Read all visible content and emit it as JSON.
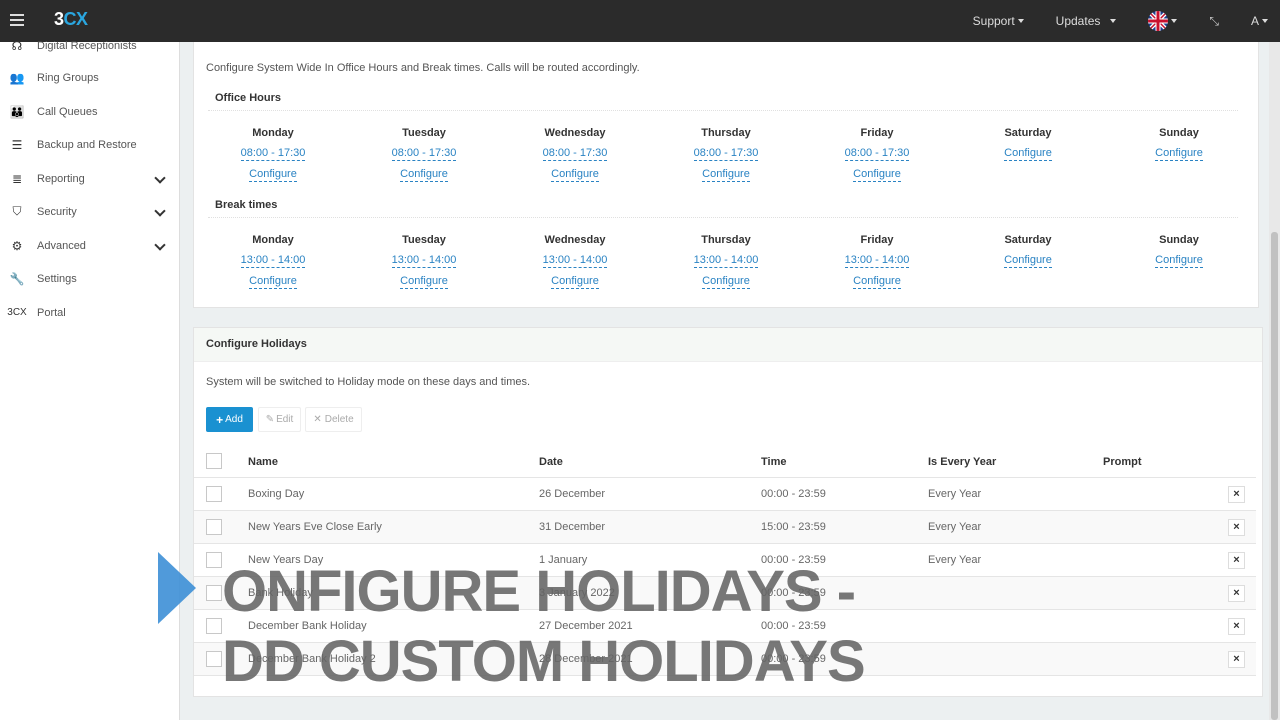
{
  "header": {
    "logo_main": "3",
    "logo_accent": "CX",
    "support_label": "Support",
    "updates_label": "Updates",
    "user_label": "A"
  },
  "sidebar": {
    "items": [
      {
        "label": "Digital Receptionists",
        "icon": "headset-icon"
      },
      {
        "label": "Ring Groups",
        "icon": "users-icon"
      },
      {
        "label": "Call Queues",
        "icon": "group-icon"
      },
      {
        "label": "Backup and Restore",
        "icon": "database-icon"
      },
      {
        "label": "Reporting",
        "icon": "list-icon"
      },
      {
        "label": "Security",
        "icon": "shield-icon"
      },
      {
        "label": "Advanced",
        "icon": "gear-icon"
      },
      {
        "label": "Settings",
        "icon": "wrench-icon"
      },
      {
        "label": "Portal",
        "icon": "3cx-icon"
      }
    ],
    "portal_icon_text": "3CX"
  },
  "office": {
    "description": "Configure System Wide In Office Hours and Break times. Calls will be routed accordingly.",
    "office_title": "Office Hours",
    "break_title": "Break times",
    "days": [
      "Monday",
      "Tuesday",
      "Wednesday",
      "Thursday",
      "Friday",
      "Saturday",
      "Sunday"
    ],
    "office_hours": [
      "08:00 - 17:30",
      "08:00 - 17:30",
      "08:00 - 17:30",
      "08:00 - 17:30",
      "08:00 - 17:30",
      "",
      ""
    ],
    "break_hours": [
      "13:00 - 14:00",
      "13:00 - 14:00",
      "13:00 - 14:00",
      "13:00 - 14:00",
      "13:00 - 14:00",
      "",
      ""
    ],
    "configure_label": "Configure"
  },
  "holidays": {
    "title": "Configure Holidays",
    "description": "System will be switched to Holiday mode on these days and times.",
    "add_label": "Add",
    "edit_label": "Edit",
    "delete_label": "Delete",
    "columns": [
      "Name",
      "Date",
      "Time",
      "Is Every Year",
      "Prompt"
    ],
    "rows": [
      {
        "name": "Boxing Day",
        "date": "26 December",
        "time": "00:00 - 23:59",
        "every_year": "Every Year"
      },
      {
        "name": "New Years Eve Close Early",
        "date": "31 December",
        "time": "15:00 - 23:59",
        "every_year": "Every Year"
      },
      {
        "name": "New Years Day",
        "date": "1 January",
        "time": "00:00 - 23:59",
        "every_year": "Every Year"
      },
      {
        "name": "Bank Holiday",
        "date": "3 January 2022",
        "time": "00:00 - 23:59",
        "every_year": ""
      },
      {
        "name": "December Bank Holiday",
        "date": "27 December 2021",
        "time": "00:00 - 23:59",
        "every_year": ""
      },
      {
        "name": "December Bank Holiday 2",
        "date": "28 December 2021",
        "time": "00:00 - 23:59",
        "every_year": ""
      }
    ]
  },
  "overlay": {
    "line1": "ONFIGURE HOLIDAYS -",
    "line2": "DD CUSTOM HOLIDAYS"
  },
  "colors": {
    "topbar": "#2b2b2b",
    "accent": "#2aa6df",
    "link": "#2a83c3",
    "add_button": "#1a91d1"
  }
}
